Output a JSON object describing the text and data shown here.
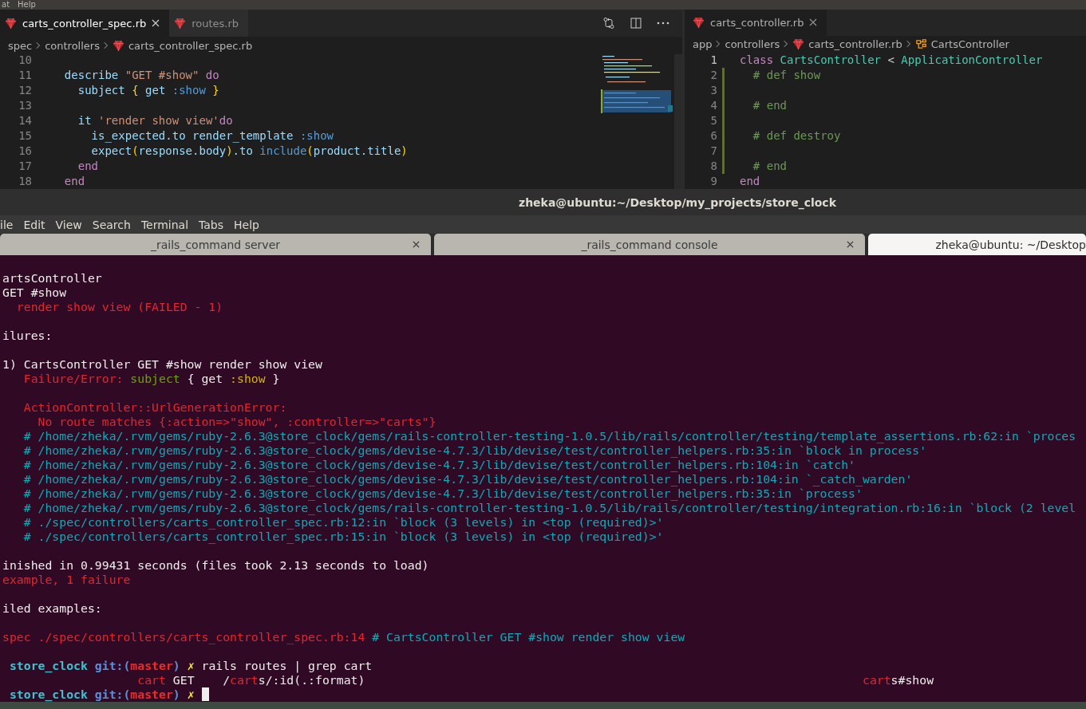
{
  "top_menu": [
    "at",
    "Help"
  ],
  "left_editor": {
    "tabs": [
      {
        "label": "carts_controller_spec.rb",
        "selected": true
      },
      {
        "label": "routes.rb",
        "selected": false
      }
    ],
    "breadcrumb": [
      {
        "label": "spec",
        "kind": "folder"
      },
      {
        "label": "controllers",
        "kind": "folder"
      },
      {
        "label": "carts_controller_spec.rb",
        "kind": "file"
      }
    ],
    "lines": [
      {
        "number": "10"
      },
      {
        "number": "11",
        "segments": [
          {
            "text": "  describe ",
            "kind": "var"
          },
          {
            "text": "\"GET #show\"",
            "kind": "str"
          },
          {
            "text": " do",
            "kind": "kw"
          }
        ]
      },
      {
        "number": "12",
        "segments": [
          {
            "text": "    subject ",
            "kind": "var"
          },
          {
            "text": "{",
            "kind": "brace"
          },
          {
            "text": " get ",
            "kind": "var"
          },
          {
            "text": ":show",
            "kind": "sym"
          },
          {
            "text": " }",
            "kind": "brace"
          }
        ]
      },
      {
        "number": "13"
      },
      {
        "number": "14",
        "segments": [
          {
            "text": "    it ",
            "kind": "var"
          },
          {
            "text": "'render show view'",
            "kind": "str"
          },
          {
            "text": "do",
            "kind": "kw"
          }
        ]
      },
      {
        "number": "15",
        "segments": [
          {
            "text": "      is_expected.to render_template ",
            "kind": "var"
          },
          {
            "text": ":show",
            "kind": "sym"
          }
        ]
      },
      {
        "number": "16",
        "segments": [
          {
            "text": "      expect",
            "kind": "var"
          },
          {
            "text": "(",
            "kind": "brace"
          },
          {
            "text": "response.body",
            "kind": "var"
          },
          {
            "text": ")",
            "kind": "brace"
          },
          {
            "text": ".to ",
            "kind": "var"
          },
          {
            "text": "include",
            "kind": "sym"
          },
          {
            "text": "(",
            "kind": "brace"
          },
          {
            "text": "product.title",
            "kind": "var"
          },
          {
            "text": ")",
            "kind": "brace"
          }
        ]
      },
      {
        "number": "17",
        "segments": [
          {
            "text": "    end",
            "kind": "kw"
          }
        ]
      },
      {
        "number": "18",
        "segments": [
          {
            "text": "  end",
            "kind": "kw"
          }
        ]
      }
    ]
  },
  "right_editor": {
    "tabs": [
      {
        "label": "carts_controller.rb",
        "selected": true
      }
    ],
    "breadcrumb": [
      {
        "label": "app",
        "kind": "folder"
      },
      {
        "label": "controllers",
        "kind": "folder"
      },
      {
        "label": "carts_controller.rb",
        "kind": "file"
      },
      {
        "label": "CartsController",
        "kind": "class"
      }
    ],
    "lines": [
      {
        "number": "1",
        "current": true,
        "modified": false,
        "segments": [
          {
            "text": "class ",
            "kind": "kw"
          },
          {
            "text": "CartsController",
            "kind": "class"
          },
          {
            "text": " < ",
            "kind": "plain"
          },
          {
            "text": "ApplicationController",
            "kind": "class"
          }
        ]
      },
      {
        "number": "2",
        "current": false,
        "modified": true,
        "segments": [
          {
            "text": "  # def show",
            "kind": "comment"
          }
        ]
      },
      {
        "number": "3",
        "current": false,
        "modified": true
      },
      {
        "number": "4",
        "current": false,
        "modified": true,
        "segments": [
          {
            "text": "  # end",
            "kind": "comment"
          }
        ]
      },
      {
        "number": "5",
        "current": false,
        "modified": true
      },
      {
        "number": "6",
        "current": false,
        "modified": true,
        "segments": [
          {
            "text": "  # def destroy",
            "kind": "comment"
          }
        ]
      },
      {
        "number": "7",
        "current": false,
        "modified": true
      },
      {
        "number": "8",
        "current": false,
        "modified": true,
        "segments": [
          {
            "text": "  # end",
            "kind": "comment"
          }
        ]
      },
      {
        "number": "9",
        "current": false,
        "modified": false,
        "segments": [
          {
            "text": "end",
            "kind": "kw"
          }
        ]
      }
    ]
  },
  "terminal": {
    "title": "zheka@ubuntu:~/Desktop/my_projects/store_clock",
    "menu": [
      "ile",
      "Edit",
      "View",
      "Search",
      "Terminal",
      "Tabs",
      "Help"
    ],
    "tabs": [
      {
        "label": "_rails_command server",
        "selected": false
      },
      {
        "label": "_rails_command console",
        "selected": false
      },
      {
        "label": "zheka@ubuntu: ~/Desktop",
        "selected": true
      }
    ],
    "blocks": [
      {
        "lines": [
          [
            {
              "text": "artsController",
              "kind": "text"
            }
          ],
          [
            {
              "text": "GET #show",
              "kind": "text"
            }
          ],
          [
            {
              "text": "  render show view (FAILED - 1)",
              "kind": "red"
            }
          ]
        ]
      },
      {
        "lines": [
          [
            {
              "text": "ilures:",
              "kind": "text"
            }
          ]
        ]
      },
      {
        "lines": [
          [
            {
              "text": "1) CartsController GET #show render show view",
              "kind": "text"
            }
          ],
          [
            {
              "text": "   Failure/Error: ",
              "kind": "red"
            },
            {
              "text": "subject",
              "kind": "green"
            },
            {
              "text": " { get ",
              "kind": "text"
            },
            {
              "text": ":show",
              "kind": "yellow"
            },
            {
              "text": " }",
              "kind": "text"
            }
          ]
        ]
      },
      {
        "lines": [
          [
            {
              "text": "   ActionController::UrlGenerationError:",
              "kind": "red"
            }
          ],
          [
            {
              "text": "     No route matches {:action=>\"show\", :controller=>\"carts\"}",
              "kind": "red"
            }
          ],
          [
            {
              "text": "   # /home/zheka/.rvm/gems/ruby-2.6.3@store_clock/gems/rails-controller-testing-1.0.5/lib/rails/controller/testing/template_assertions.rb:62:in `proces",
              "kind": "cyan"
            }
          ],
          [
            {
              "text": "   # /home/zheka/.rvm/gems/ruby-2.6.3@store_clock/gems/devise-4.7.3/lib/devise/test/controller_helpers.rb:35:in `block in process'",
              "kind": "cyan"
            }
          ],
          [
            {
              "text": "   # /home/zheka/.rvm/gems/ruby-2.6.3@store_clock/gems/devise-4.7.3/lib/devise/test/controller_helpers.rb:104:in `catch'",
              "kind": "cyan"
            }
          ],
          [
            {
              "text": "   # /home/zheka/.rvm/gems/ruby-2.6.3@store_clock/gems/devise-4.7.3/lib/devise/test/controller_helpers.rb:104:in `_catch_warden'",
              "kind": "cyan"
            }
          ],
          [
            {
              "text": "   # /home/zheka/.rvm/gems/ruby-2.6.3@store_clock/gems/devise-4.7.3/lib/devise/test/controller_helpers.rb:35:in `process'",
              "kind": "cyan"
            }
          ],
          [
            {
              "text": "   # /home/zheka/.rvm/gems/ruby-2.6.3@store_clock/gems/rails-controller-testing-1.0.5/lib/rails/controller/testing/integration.rb:16:in `block (2 level",
              "kind": "cyan"
            }
          ],
          [
            {
              "text": "   # ./spec/controllers/carts_controller_spec.rb:12:in `block (3 levels) in <top (required)>'",
              "kind": "cyan"
            }
          ],
          [
            {
              "text": "   # ./spec/controllers/carts_controller_spec.rb:15:in `block (3 levels) in <top (required)>'",
              "kind": "cyan"
            }
          ]
        ]
      },
      {
        "lines": [
          [
            {
              "text": "inished in 0.99431 seconds (files took 2.13 seconds to load)",
              "kind": "text"
            }
          ],
          [
            {
              "text": "example, 1 failure",
              "kind": "red"
            }
          ]
        ]
      },
      {
        "lines": [
          [
            {
              "text": "iled examples:",
              "kind": "text"
            }
          ]
        ]
      },
      {
        "lines": [
          [
            {
              "text": "spec ./spec/controllers/carts_controller_spec.rb:14",
              "kind": "red"
            },
            {
              "text": " # CartsController GET #show render show view",
              "kind": "cyan"
            }
          ]
        ]
      },
      {
        "lines": [
          [
            {
              "text": " store_clock",
              "kind": "dir"
            },
            {
              "text": " git:(",
              "kind": "git"
            },
            {
              "text": "master",
              "kind": "branch"
            },
            {
              "text": ")",
              "kind": "git"
            },
            {
              "text": " ✗",
              "kind": "mark"
            },
            {
              "text": " rails routes | grep cart",
              "kind": "text"
            }
          ],
          [
            {
              "text": "                   cart",
              "kind": "red"
            },
            {
              "text": " GET    /",
              "kind": "text"
            },
            {
              "text": "cart",
              "kind": "red"
            },
            {
              "text": "s/:id(.:format)                                                                      ",
              "kind": "text"
            },
            {
              "text": "cart",
              "kind": "red"
            },
            {
              "text": "s#show",
              "kind": "text"
            }
          ],
          [
            {
              "text": " store_clock",
              "kind": "dir"
            },
            {
              "text": " git:(",
              "kind": "git"
            },
            {
              "text": "master",
              "kind": "branch"
            },
            {
              "text": ")",
              "kind": "git"
            },
            {
              "text": " ✗",
              "kind": "mark"
            }
          ]
        ]
      }
    ]
  }
}
